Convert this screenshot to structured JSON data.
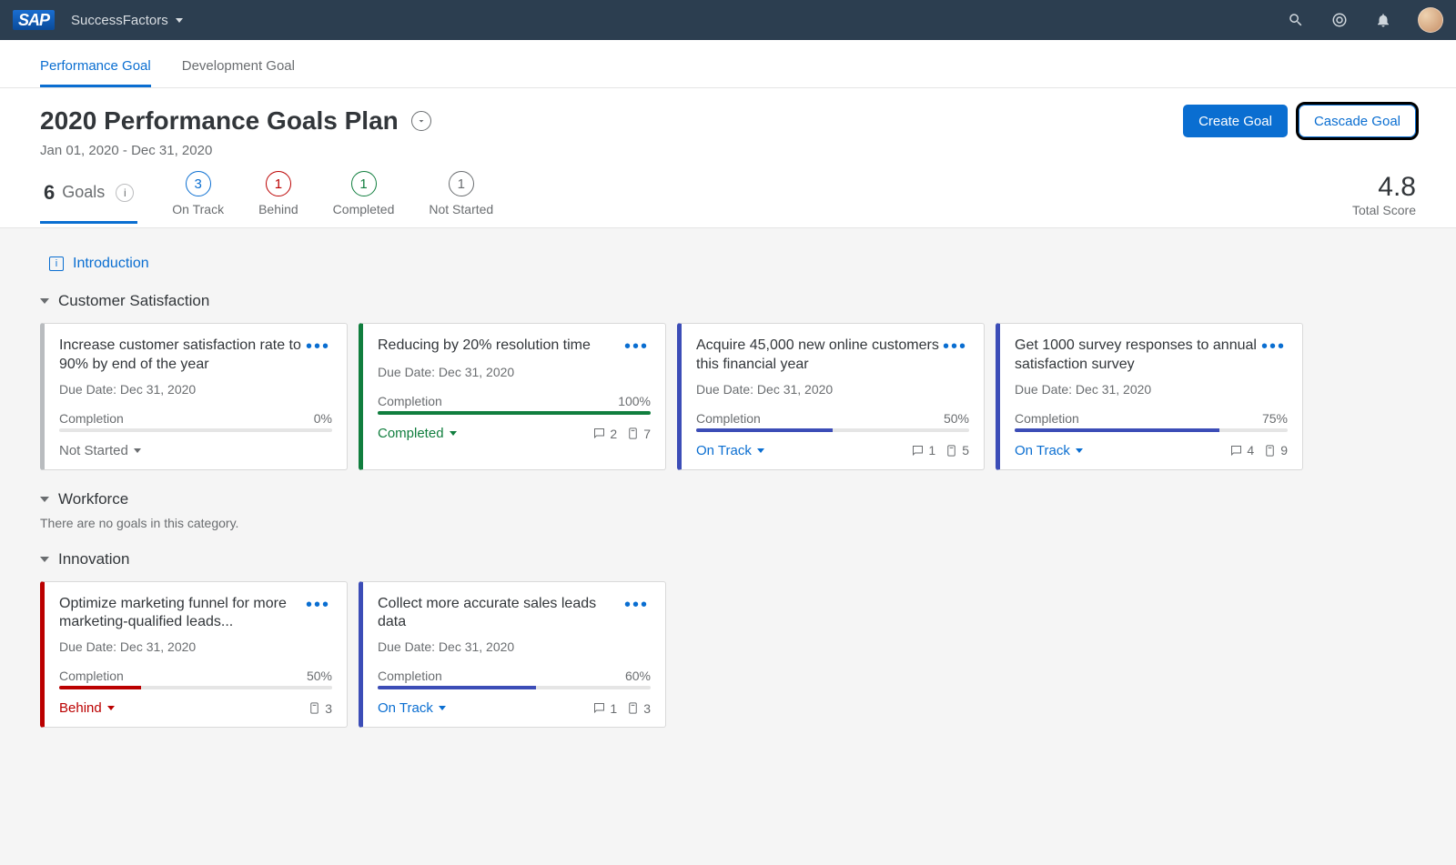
{
  "shell": {
    "logo": "SAP",
    "app_name": "SuccessFactors"
  },
  "tabs": {
    "performance": "Performance Goal",
    "development": "Development Goal"
  },
  "header": {
    "title": "2020 Performance Goals Plan",
    "date_range": "Jan 01, 2020 - Dec 31, 2020",
    "create_goal": "Create Goal",
    "cascade_goal": "Cascade Goal"
  },
  "filters": {
    "goals_count": "6",
    "goals_label": "Goals",
    "on_track": {
      "count": "3",
      "label": "On Track"
    },
    "behind": {
      "count": "1",
      "label": "Behind"
    },
    "completed": {
      "count": "1",
      "label": "Completed"
    },
    "not_started": {
      "count": "1",
      "label": "Not Started"
    },
    "score_value": "4.8",
    "score_label": "Total Score"
  },
  "intro_label": "Introduction",
  "sections": {
    "customer_satisfaction": {
      "title": "Customer Satisfaction",
      "cards": [
        {
          "title": "Increase customer satisfaction rate to 90% by end of the year",
          "due": "Due Date: Dec 31, 2020",
          "comp_label": "Completion",
          "comp_value": "0%",
          "progress": 0,
          "status": "Not Started",
          "status_class": "not-started",
          "accent": "not-started",
          "comments": null,
          "attachments": null
        },
        {
          "title": "Reducing by 20% resolution time",
          "due": "Due Date: Dec 31, 2020",
          "comp_label": "Completion",
          "comp_value": "100%",
          "progress": 100,
          "status": "Completed",
          "status_class": "completed",
          "accent": "completed",
          "comments": "2",
          "attachments": "7"
        },
        {
          "title": "Acquire 45,000 new online customers this financial year",
          "due": "Due Date: Dec 31, 2020",
          "comp_label": "Completion",
          "comp_value": "50%",
          "progress": 50,
          "status": "On Track",
          "status_class": "on-track",
          "accent": "on-track",
          "comments": "1",
          "attachments": "5"
        },
        {
          "title": "Get 1000 survey responses to annual satisfaction survey",
          "due": "Due Date: Dec 31, 2020",
          "comp_label": "Completion",
          "comp_value": "75%",
          "progress": 75,
          "status": "On Track",
          "status_class": "on-track",
          "accent": "on-track",
          "comments": "4",
          "attachments": "9"
        }
      ]
    },
    "workforce": {
      "title": "Workforce",
      "empty": "There are no goals in this category."
    },
    "innovation": {
      "title": "Innovation",
      "cards": [
        {
          "title": "Optimize marketing funnel for more marketing-qualified leads...",
          "due": "Due Date: Dec 31, 2020",
          "comp_label": "Completion",
          "comp_value": "50%",
          "progress": 30,
          "status": "Behind",
          "status_class": "behind",
          "accent": "behind",
          "comments": null,
          "attachments": "3"
        },
        {
          "title": "Collect more accurate sales leads data",
          "due": "Due Date: Dec 31, 2020",
          "comp_label": "Completion",
          "comp_value": "60%",
          "progress": 58,
          "status": "On Track",
          "status_class": "on-track",
          "accent": "on-track",
          "comments": "1",
          "attachments": "3"
        }
      ]
    }
  },
  "colors": {
    "completed": "#107e3e",
    "on-track": "#3c4db7",
    "behind": "#bb0000",
    "not-started": "#b9bcbf"
  }
}
